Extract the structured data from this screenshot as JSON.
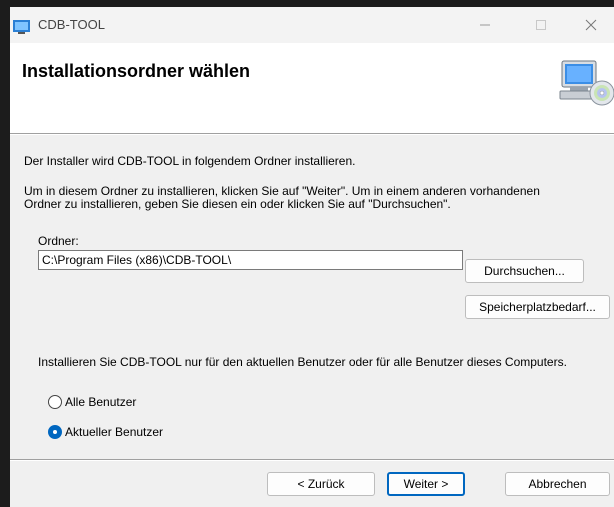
{
  "window": {
    "title": "CDB-TOOL",
    "app_icon": "installer-app-icon",
    "controls": [
      "minimize-icon",
      "maximize-icon",
      "close-icon"
    ]
  },
  "header": {
    "title": "Installationsordner wählen",
    "icon": "computer-cd-icon"
  },
  "body": {
    "intro": "Der Installer wird CDB-TOOL in folgendem Ordner installieren.",
    "instructions_line1": "Um in diesem Ordner zu installieren, klicken Sie auf \"Weiter\". Um in einem anderen vorhandenen",
    "instructions_line2": "Ordner zu installieren, geben Sie diesen ein oder klicken Sie auf \"Durchsuchen\".",
    "folder_label": "Ordner:",
    "folder_value": "C:\\Program Files (x86)\\CDB-TOOL\\",
    "browse_label": "Durchsuchen...",
    "disk_cost_label": "Speicherplatzbedarf...",
    "scope_text": "Installieren Sie CDB-TOOL nur für den aktuellen Benutzer oder für alle Benutzer dieses Computers.",
    "radio_all": "Alle Benutzer",
    "radio_current": "Aktueller Benutzer",
    "selected_scope": "Aktueller Benutzer"
  },
  "footer": {
    "back_label": "< Zurück",
    "next_label": "Weiter >",
    "cancel_label": "Abbrechen"
  },
  "colors": {
    "accent": "#0067c0",
    "dialog_bg": "#f0f0f0",
    "header_bg": "#ffffff"
  }
}
